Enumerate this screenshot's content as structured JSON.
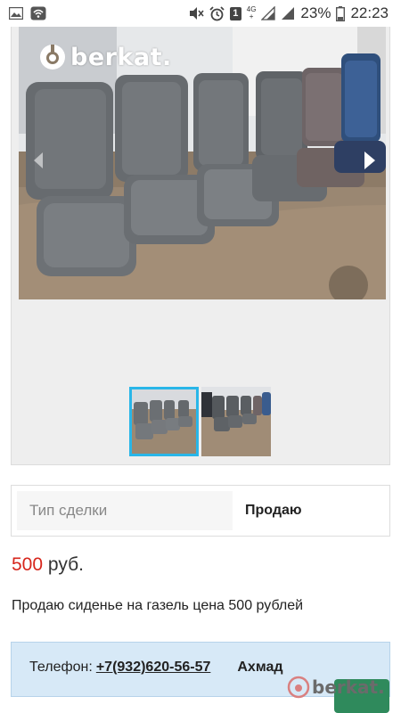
{
  "status_bar": {
    "icons": [
      "gallery-notification-icon",
      "wifi-notification-icon",
      "mute-icon",
      "alarm-icon",
      "sim-icon",
      "lte-icon",
      "signal-icon",
      "signal-icon-2",
      "battery-icon"
    ],
    "sim_number": "1",
    "network_top": "4G",
    "network_bottom": "+",
    "battery": "23%",
    "time": "22:23"
  },
  "gallery": {
    "logo": "berkat.",
    "thumbnail_count": 2,
    "active_thumbnail": 1
  },
  "details": {
    "deal_label": "Тип сделки",
    "deal_value": "Продаю"
  },
  "price": {
    "amount": "500",
    "currency": "руб."
  },
  "description": "Продаю сиденье на газель цена 500 рублей",
  "contact": {
    "phone_label": "Телефон:",
    "phone": "+7(932)620-56-57",
    "name": "Ахмад"
  },
  "watermark": "berkat."
}
